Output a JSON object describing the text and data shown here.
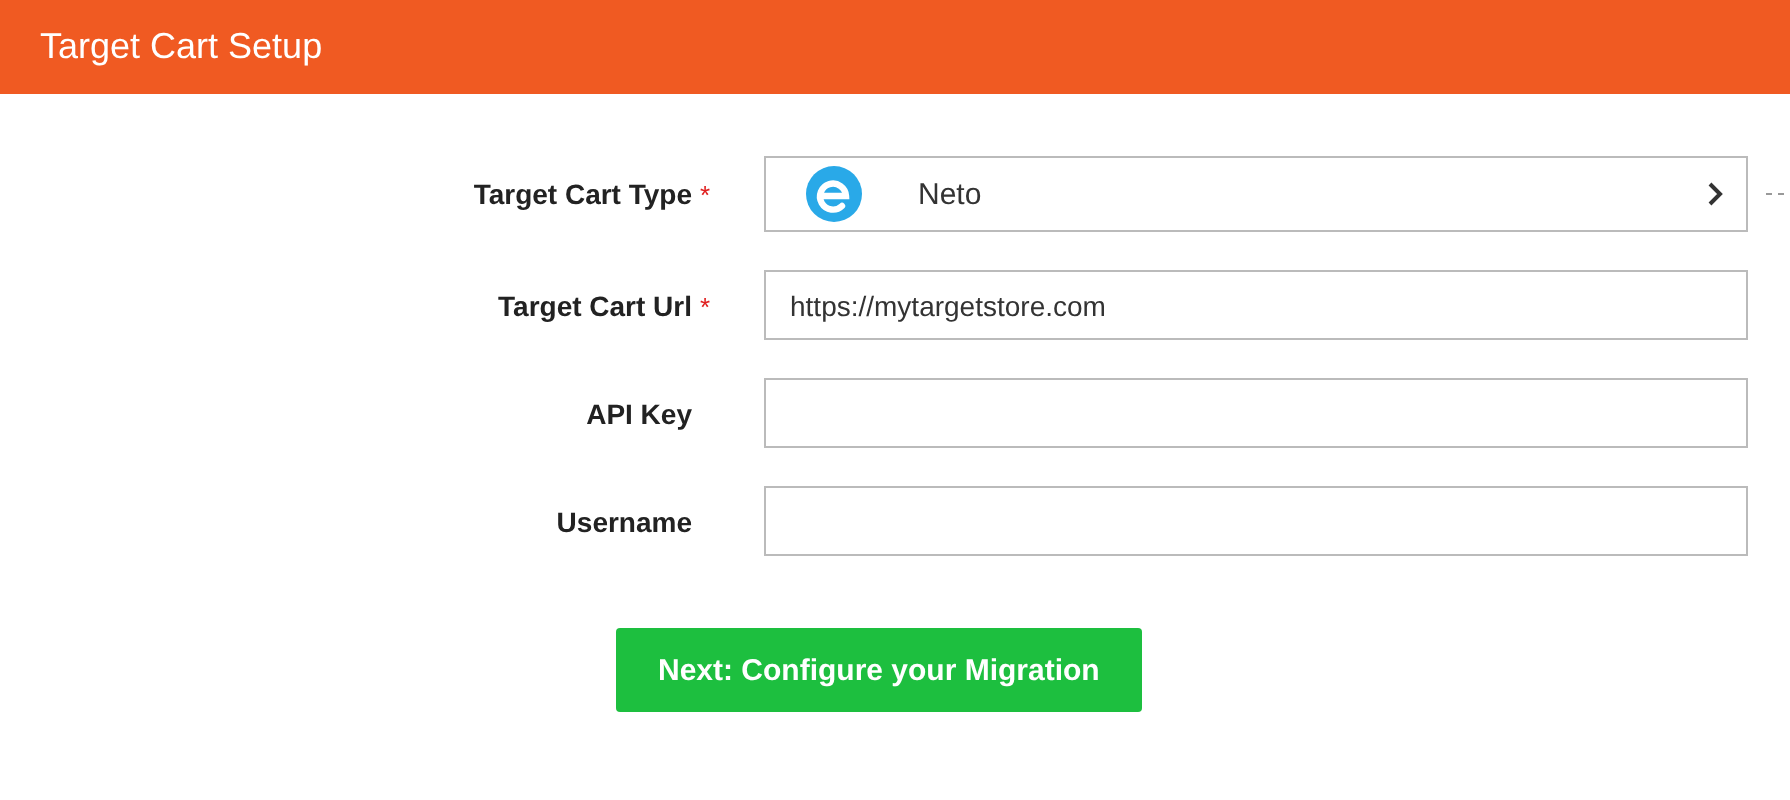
{
  "header": {
    "title": "Target Cart Setup"
  },
  "fields": [
    {
      "kind": "select",
      "label": "Target Cart Type",
      "required_mark": "*",
      "value": "Neto"
    },
    {
      "kind": "text",
      "label": "Target Cart Url",
      "required_mark": "*",
      "value": "https://mytargetstore.com"
    },
    {
      "kind": "text",
      "label": "API Key"
    },
    {
      "kind": "text",
      "label": "Username"
    }
  ],
  "submit_button": {
    "label": "Next: Configure your Migration"
  }
}
